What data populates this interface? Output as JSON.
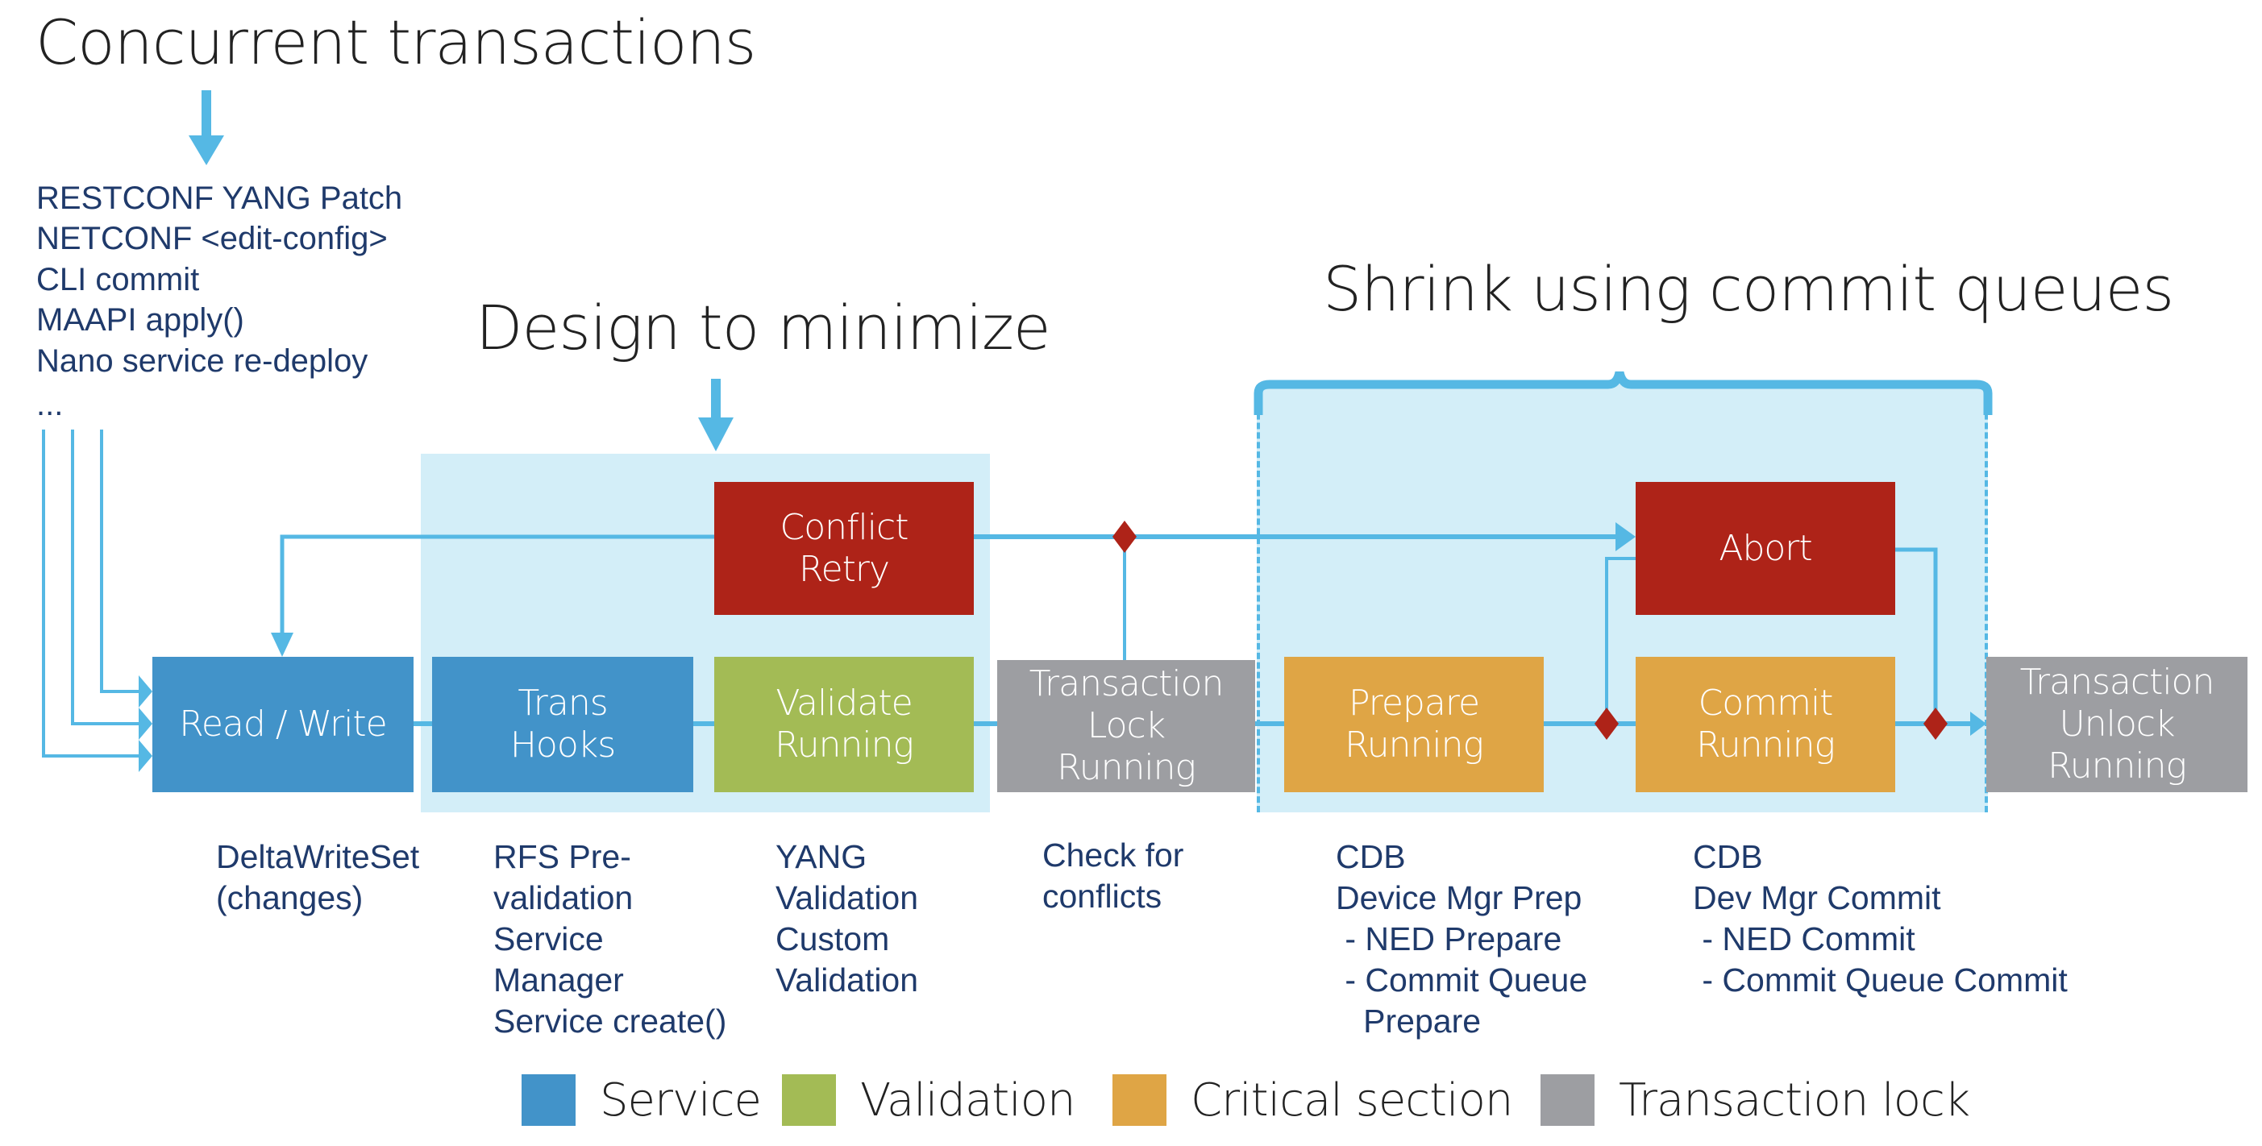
{
  "headings": {
    "concurrent": "Concurrent transactions",
    "design": "Design to minimize",
    "shrink": "Shrink using commit queues"
  },
  "sources": [
    "RESTCONF YANG Patch",
    "NETCONF <edit-config>",
    "CLI commit",
    "MAAPI apply()",
    "Nano service re-deploy",
    "..."
  ],
  "colors": {
    "service": "#4293c9",
    "validation": "#a3bb55",
    "critical": "#dfa545",
    "lock": "#9d9ea2",
    "error": "#ae2318",
    "connector": "#55b8e4",
    "region": "#d3eef8",
    "text": "#1f3a6b"
  },
  "boxes": {
    "read_write": "Read / Write",
    "trans_hooks": "Trans\nHooks",
    "validate": "Validate\nRunning",
    "conflict": "Conflict\nRetry",
    "lock": "Transaction\nLock\nRunning",
    "prepare": "Prepare\nRunning",
    "abort": "Abort",
    "commit": "Commit\nRunning",
    "unlock": "Transaction\nUnlock\nRunning"
  },
  "notes": {
    "read_write": [
      {
        "text": "DeltaWriteSet\n(changes)",
        "bullet": true
      }
    ],
    "trans_hooks": [
      {
        "text": "RFS Pre-\nvalidation",
        "bullet": true
      },
      {
        "text": "Service\nManager\nService create()",
        "bullet": true
      }
    ],
    "validate": [
      {
        "text": "YANG\nValidation",
        "bullet": true
      },
      {
        "text": "Custom\nValidation",
        "bullet": true
      }
    ],
    "lock": [
      {
        "text": "Check for\nconflicts",
        "bullet": true
      }
    ],
    "prepare": [
      {
        "text": "CDB",
        "bullet": true
      },
      {
        "text": "Device Mgr Prep\n - NED Prepare\n - Commit Queue\n   Prepare",
        "bullet": true
      }
    ],
    "commit": [
      {
        "text": "CDB",
        "bullet": true
      },
      {
        "text": "Dev Mgr Commit\n - NED Commit\n - Commit Queue Commit",
        "bullet": true
      }
    ]
  },
  "legend": [
    {
      "label": "Service",
      "color": "#4293c9"
    },
    {
      "label": "Validation",
      "color": "#a3bb55"
    },
    {
      "label": "Critical section",
      "color": "#dfa545"
    },
    {
      "label": "Transaction lock",
      "color": "#9d9ea2"
    }
  ]
}
